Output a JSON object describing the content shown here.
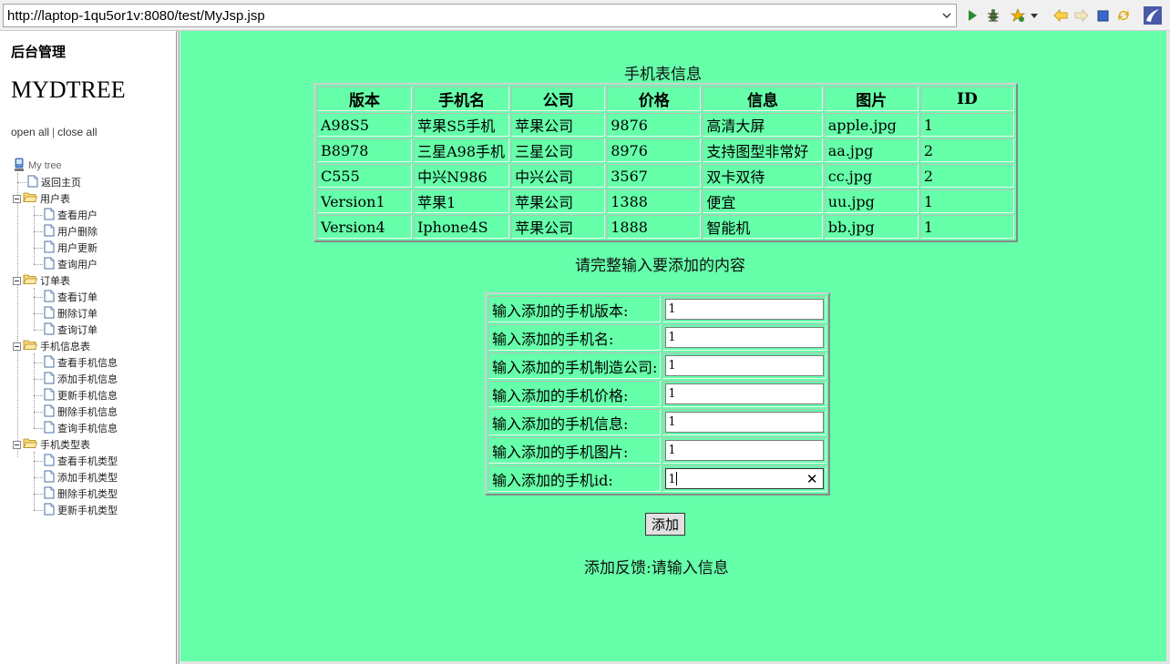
{
  "toolbar": {
    "url": "http://laptop-1qu5or1v:8080/test/MyJsp.jsp",
    "buttons": [
      "go-icon",
      "debug-icon",
      "bookmark-icon",
      "dropdown-icon",
      "back-icon",
      "forward-icon",
      "stop-icon",
      "refresh-icon",
      "eclipse-icon"
    ]
  },
  "sidebar": {
    "title": "后台管理",
    "tree_title": "MYDTREE",
    "open_all": "open all",
    "separator": "|",
    "close_all": "close all",
    "root": "My tree",
    "home": "返回主页",
    "groups": [
      {
        "label": "用户表",
        "items": [
          "查看用户",
          "用户删除",
          "用户更新",
          "查询用户"
        ]
      },
      {
        "label": "订单表",
        "items": [
          "查看订单",
          "删除订单",
          "查询订单"
        ]
      },
      {
        "label": "手机信息表",
        "items": [
          "查看手机信息",
          "添加手机信息",
          "更新手机信息",
          "删除手机信息",
          "查询手机信息"
        ]
      },
      {
        "label": "手机类型表",
        "items": [
          "查看手机类型",
          "添加手机类型",
          "删除手机类型",
          "更新手机类型"
        ]
      }
    ]
  },
  "main": {
    "table_caption": "手机表信息",
    "table": {
      "headers": [
        "版本",
        "手机名",
        "公司",
        "价格",
        "信息",
        "图片",
        "ID"
      ],
      "rows": [
        [
          "A98S5",
          "苹果S5手机",
          "苹果公司",
          "9876",
          "高清大屏",
          "apple.jpg",
          "1"
        ],
        [
          "B8978",
          "三星A98手机",
          "三星公司",
          "8976",
          "支持图型非常好",
          "aa.jpg",
          "2"
        ],
        [
          "C555",
          "中兴N986",
          "中兴公司",
          "3567",
          "双卡双待",
          "cc.jpg",
          "2"
        ],
        [
          "Version1",
          "苹果1",
          "苹果公司",
          "1388",
          "便宜",
          "uu.jpg",
          "1"
        ],
        [
          "Version4",
          "Iphone4S",
          "苹果公司",
          "1888",
          "智能机",
          "bb.jpg",
          "1"
        ]
      ]
    },
    "form_caption": "请完整输入要添加的内容",
    "form": [
      {
        "label": "输入添加的手机版本:",
        "value": "1"
      },
      {
        "label": "输入添加的手机名:",
        "value": "1"
      },
      {
        "label": "输入添加的手机制造公司:",
        "value": "1"
      },
      {
        "label": "输入添加的手机价格:",
        "value": "1"
      },
      {
        "label": "输入添加的手机信息:",
        "value": "1"
      },
      {
        "label": "输入添加的手机图片:",
        "value": "1"
      },
      {
        "label": "输入添加的手机id:",
        "value": "1"
      }
    ],
    "clear_glyph": "✕",
    "add_button": "添加",
    "feedback": "添加反馈:请输入信息"
  },
  "colors": {
    "main_background": "#66ffaa",
    "sidebar_background": "#ffffff"
  }
}
